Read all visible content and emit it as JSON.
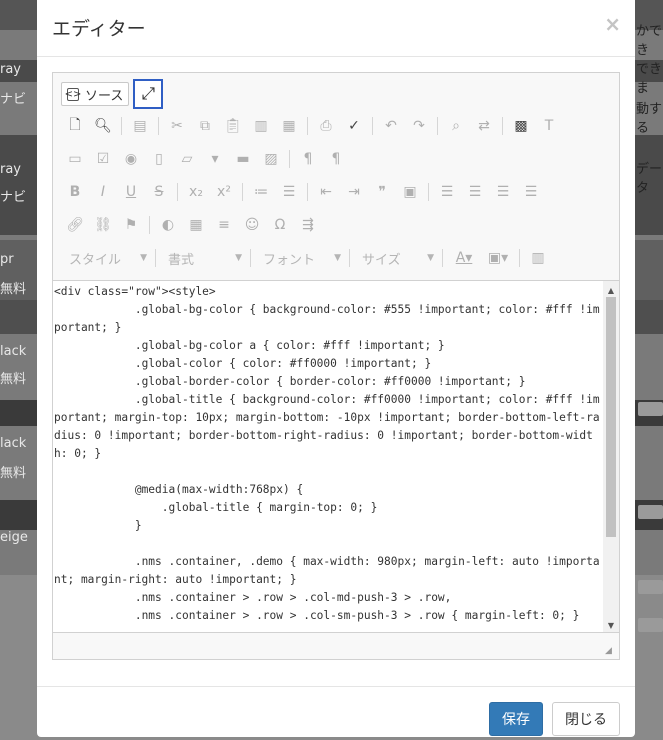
{
  "background": {
    "left_labels": [
      "ray",
      "ナビ",
      "ray",
      "ナビ",
      "pr",
      "無料",
      "lack",
      "無料",
      "lack",
      "無料",
      "eige"
    ],
    "right_labels": [
      "かでき",
      "できま",
      "動する",
      "データ"
    ]
  },
  "modal": {
    "title": "エディター",
    "close_symbol": "×",
    "save_label": "保存",
    "close_label": "閉じる"
  },
  "toolbar": {
    "source_label": "ソース",
    "combos": {
      "style": "スタイル",
      "format": "書式",
      "font": "フォント",
      "size": "サイズ"
    }
  },
  "code_text": "<div class=\"row\"><style>\n            .global-bg-color { background-color: #555 !important; color: #fff !important; }\n            .global-bg-color a { color: #fff !important; }\n            .global-color { color: #ff0000 !important; }\n            .global-border-color { border-color: #ff0000 !important; }\n            .global-title { background-color: #ff0000 !important; color: #fff !important; margin-top: 10px; margin-bottom: -10px !important; border-bottom-left-radius: 0 !important; border-bottom-right-radius: 0 !important; border-bottom-width: 0; }\n\n            @media(max-width:768px) {\n                .global-title { margin-top: 0; }\n            }\n\n            .nms .container, .demo { max-width: 980px; margin-left: auto !important; margin-right: auto !important; }\n            .nms .container > .row > .col-md-push-3 > .row,\n            .nms .container > .row > .col-sm-push-3 > .row { margin-left: 0; }"
}
